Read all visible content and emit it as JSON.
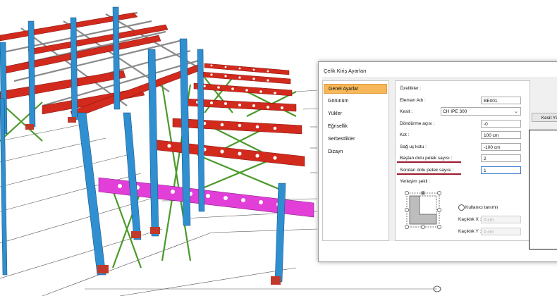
{
  "dialog": {
    "title": "Çelik Kiriş Ayarları",
    "nav": [
      "Genel Ayarlar",
      "Görünüm",
      "Yükler",
      "Eğrisellik",
      "Serbestlikler",
      "Dizayn"
    ],
    "active_nav": "Genel Ayarlar",
    "section_title": "Özellikler :",
    "fields": {
      "element_name": {
        "label": "Eleman Adı :",
        "value": "BE001"
      },
      "section": {
        "label": "Kesit :",
        "value": "CH IPE 300"
      },
      "rotation": {
        "label": "Döndürme açısı :",
        "value": "-0"
      },
      "elevation": {
        "label": "Kot :",
        "value": "100 cm"
      },
      "right_end_elev": {
        "label": "Sağ uç kotu :",
        "value": "-100 cm"
      },
      "start_full_cells": {
        "label": "Baştan dolu petek sayısı :",
        "value": "2"
      },
      "end_full_cells": {
        "label": "Sondan dolu petek sayısı :",
        "value": "1"
      }
    },
    "placement_label": "Yerleşim şekli :",
    "custom_radio_label": "Kullanıcı tanımlı",
    "offset_x": {
      "label": "Kaçıklık X :",
      "value": "0 cm"
    },
    "offset_y": {
      "label": "Kaçıklık Y :",
      "value": "0 cm"
    },
    "load_section_button": "Kesit Yükle"
  },
  "colors": {
    "beam_red": "#d22a1d",
    "column_blue": "#2f8fd0",
    "brace_green": "#4a9a2a",
    "highlight_magenta": "#e23fd9",
    "nav_active": "#f6b859",
    "underline": "#9c1a2e"
  }
}
